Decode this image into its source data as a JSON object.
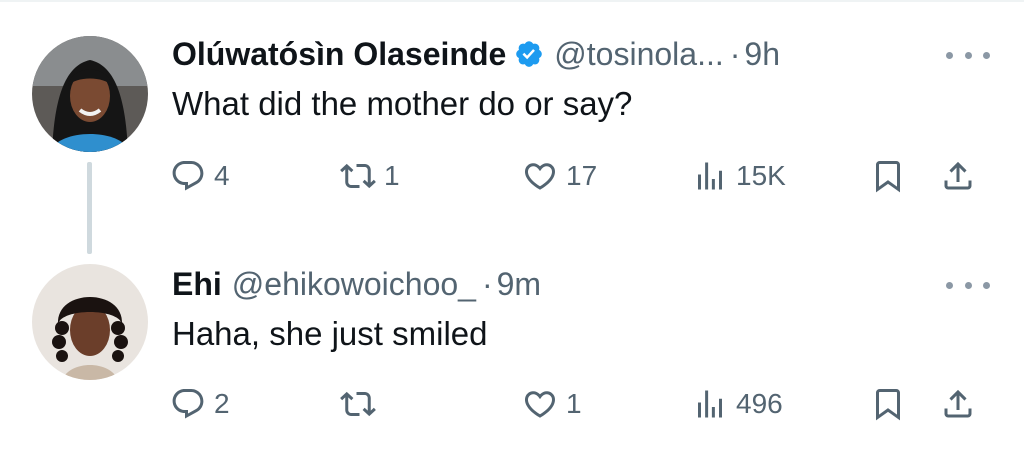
{
  "tweets": [
    {
      "author_name": "Olúwatósìn Olaseinde",
      "verified": true,
      "handle": "@tosinola...",
      "separator": "·",
      "time": "9h",
      "text": "What did the mother do or say?",
      "replies": "4",
      "reposts": "1",
      "likes": "17",
      "views": "15K"
    },
    {
      "author_name": "Ehi",
      "verified": false,
      "handle": "@ehikowoichoo_",
      "separator": "·",
      "time": "9m",
      "text": "Haha, she just smiled",
      "replies": "2",
      "reposts": "",
      "likes": "1",
      "views": "496"
    }
  ],
  "icons": {
    "reply": "reply-icon",
    "repost": "repost-icon",
    "like": "like-icon",
    "views": "views-icon",
    "bookmark": "bookmark-icon",
    "share": "share-icon",
    "more": "more-icon",
    "verified": "verified-badge-icon"
  },
  "colors": {
    "text_primary": "#0f1419",
    "text_secondary": "#536471",
    "verified_blue": "#1d9bf0",
    "thread_line": "#cfd9de"
  }
}
